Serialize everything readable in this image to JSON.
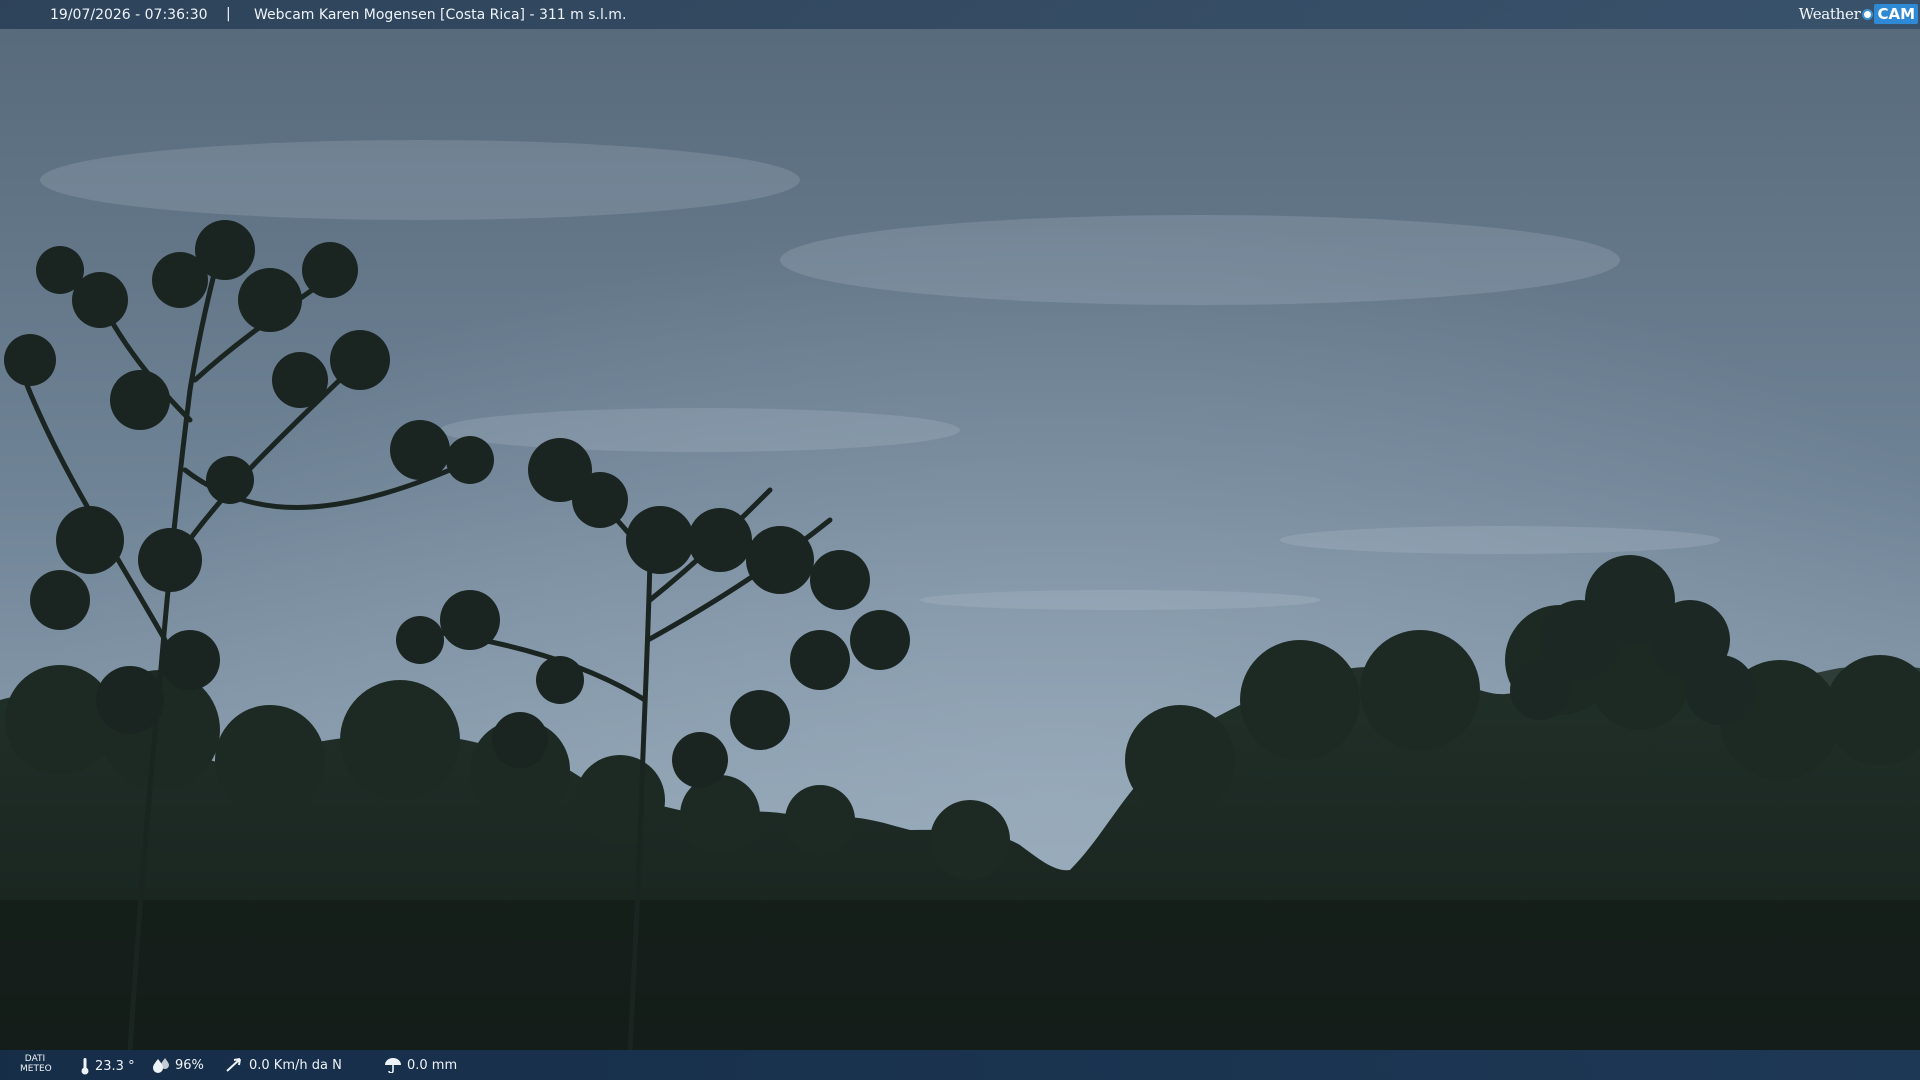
{
  "header": {
    "datetime": "19/07/2026 - 07:36:30",
    "separator": "|",
    "title": "Webcam Karen Mogensen [Costa Rica]  - 311 m s.l.m."
  },
  "logo": {
    "word": "Weather",
    "accent": "CAM",
    "icon": "weathercam-dot-icon"
  },
  "footer": {
    "label_line1": "DATI",
    "label_line2": "METEO",
    "temperature": "23.3 °",
    "humidity": "96%",
    "wind": "0.0 Km/h da N",
    "rain": "0.0 mm"
  },
  "colors": {
    "sky_top": "#5b6f80",
    "sky_bottom": "#8b9fb1",
    "foliage": "#1b2620",
    "bar": "#1e3a5a"
  }
}
